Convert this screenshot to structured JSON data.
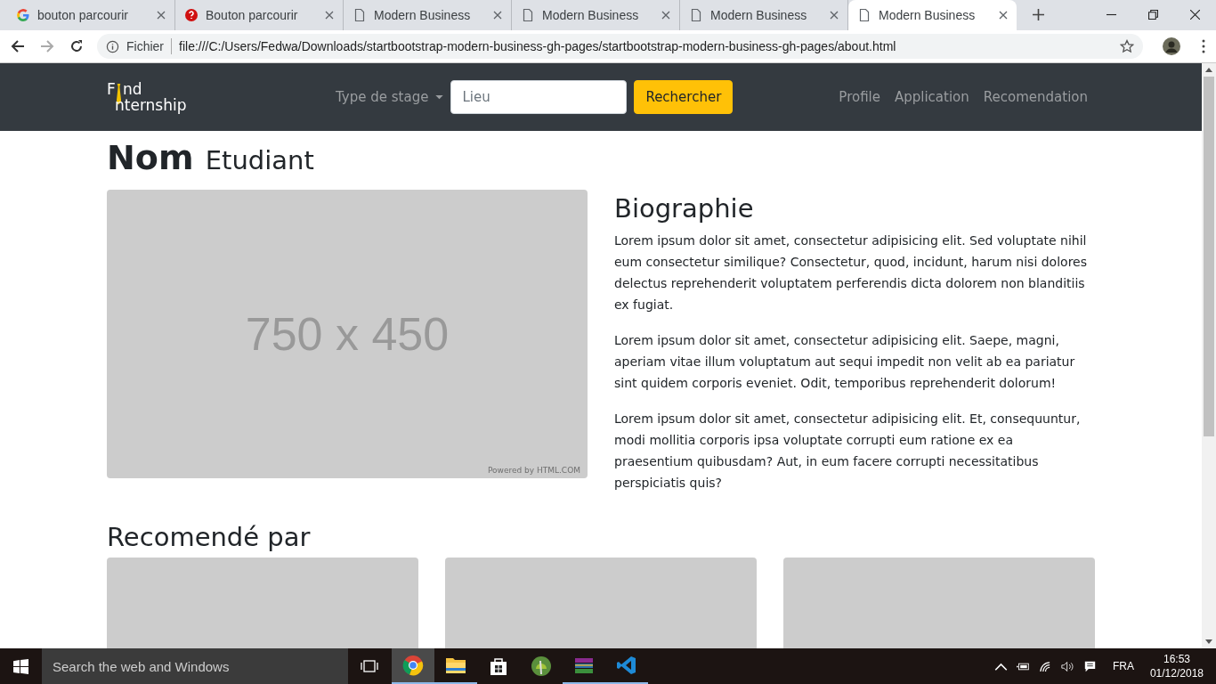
{
  "browser": {
    "tabs": [
      {
        "title": "bouton parcourir",
        "kind": "google",
        "selected": false
      },
      {
        "title": "Bouton parcourir",
        "kind": "quora",
        "selected": false
      },
      {
        "title": "Modern Business",
        "kind": "page",
        "selected": false
      },
      {
        "title": "Modern Business",
        "kind": "page",
        "selected": false
      },
      {
        "title": "Modern Business",
        "kind": "page",
        "selected": false
      },
      {
        "title": "Modern Business",
        "kind": "page",
        "selected": true
      }
    ],
    "address": {
      "scheme_label": "Fichier",
      "url": "file:///C:/Users/Fedwa/Downloads/startbootstrap-modern-business-gh-pages/startbootstrap-modern-business-gh-pages/about.html"
    }
  },
  "navbar": {
    "logo_top": [
      "F",
      "nd"
    ],
    "logo_bottom": "nternship",
    "dropdown": "Type de stage",
    "search": {
      "placeholder": "Lieu"
    },
    "search_button": "Rechercher",
    "links": [
      "Profile",
      "Application",
      "Recomendation"
    ]
  },
  "heading": {
    "main": "Nom",
    "sub": "Etudiant"
  },
  "image": {
    "caption": "750 x 450",
    "credit": "Powered by HTML.COM"
  },
  "bio": {
    "title": "Biographie",
    "paragraphs": [
      "Lorem ipsum dolor sit amet, consectetur adipisicing elit. Sed voluptate nihil eum consectetur similique? Consectetur, quod, incidunt, harum nisi dolores delectus reprehenderit voluptatem perferendis dicta dolorem non blanditiis ex fugiat.",
      "Lorem ipsum dolor sit amet, consectetur adipisicing elit. Saepe, magni, aperiam vitae illum voluptatum aut sequi impedit non velit ab ea pariatur sint quidem corporis eveniet. Odit, temporibus reprehenderit dolorum!",
      "Lorem ipsum dolor sit amet, consectetur adipisicing elit. Et, consequuntur, modi mollitia corporis ipsa voluptate corrupti eum ratione ex ea praesentium quibusdam? Aut, in eum facere corrupti necessitatibus perspiciatis quis?"
    ]
  },
  "recommended": {
    "title": "Recomendé par"
  },
  "taskbar": {
    "search": "Search the web and Windows",
    "apps": [
      {
        "kind": "chrome",
        "running": true,
        "selected": true
      },
      {
        "kind": "explorer",
        "running": true,
        "selected": false
      },
      {
        "kind": "store",
        "running": false,
        "selected": false
      },
      {
        "kind": "android",
        "running": false,
        "selected": false
      },
      {
        "kind": "winrar",
        "running": true,
        "selected": false
      },
      {
        "kind": "vscode",
        "running": true,
        "selected": false
      }
    ],
    "language": "FRA",
    "time": "16:53",
    "date": "01/12/2018"
  }
}
